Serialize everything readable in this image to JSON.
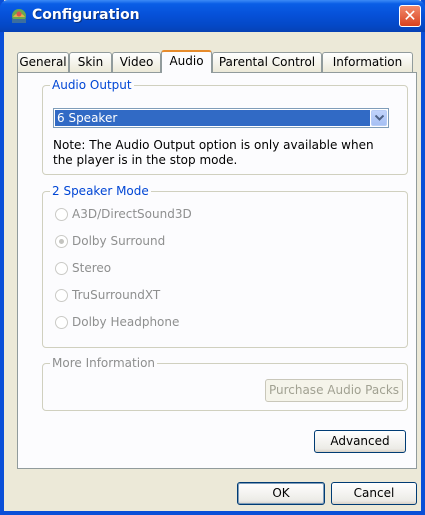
{
  "window": {
    "title": "Configuration",
    "close_label": "✕"
  },
  "tabs": [
    {
      "label": "General"
    },
    {
      "label": "Skin"
    },
    {
      "label": "Video"
    },
    {
      "label": "Audio"
    },
    {
      "label": "Parental Control"
    },
    {
      "label": "Information"
    }
  ],
  "active_tab": "Audio",
  "audio_output": {
    "legend": "Audio Output",
    "selected": "6 Speaker",
    "note": "Note:  The Audio Output option is only available when the player is in the stop mode."
  },
  "speaker_mode": {
    "legend": "2 Speaker Mode",
    "options": [
      {
        "label": "A3D/DirectSound3D",
        "checked": false
      },
      {
        "label": "Dolby Surround",
        "checked": true
      },
      {
        "label": "Stereo",
        "checked": false
      },
      {
        "label": "TruSurroundXT",
        "checked": false
      },
      {
        "label": "Dolby Headphone",
        "checked": false
      }
    ]
  },
  "more_info": {
    "legend": "More Information",
    "purchase_label": "Purchase Audio Packs"
  },
  "buttons": {
    "advanced": "Advanced",
    "ok": "OK",
    "cancel": "Cancel"
  },
  "colors": {
    "titlebar": "#0651d9",
    "accent_tab": "#e68b2c",
    "legend_blue": "#0046d5",
    "selection": "#316ac5"
  }
}
